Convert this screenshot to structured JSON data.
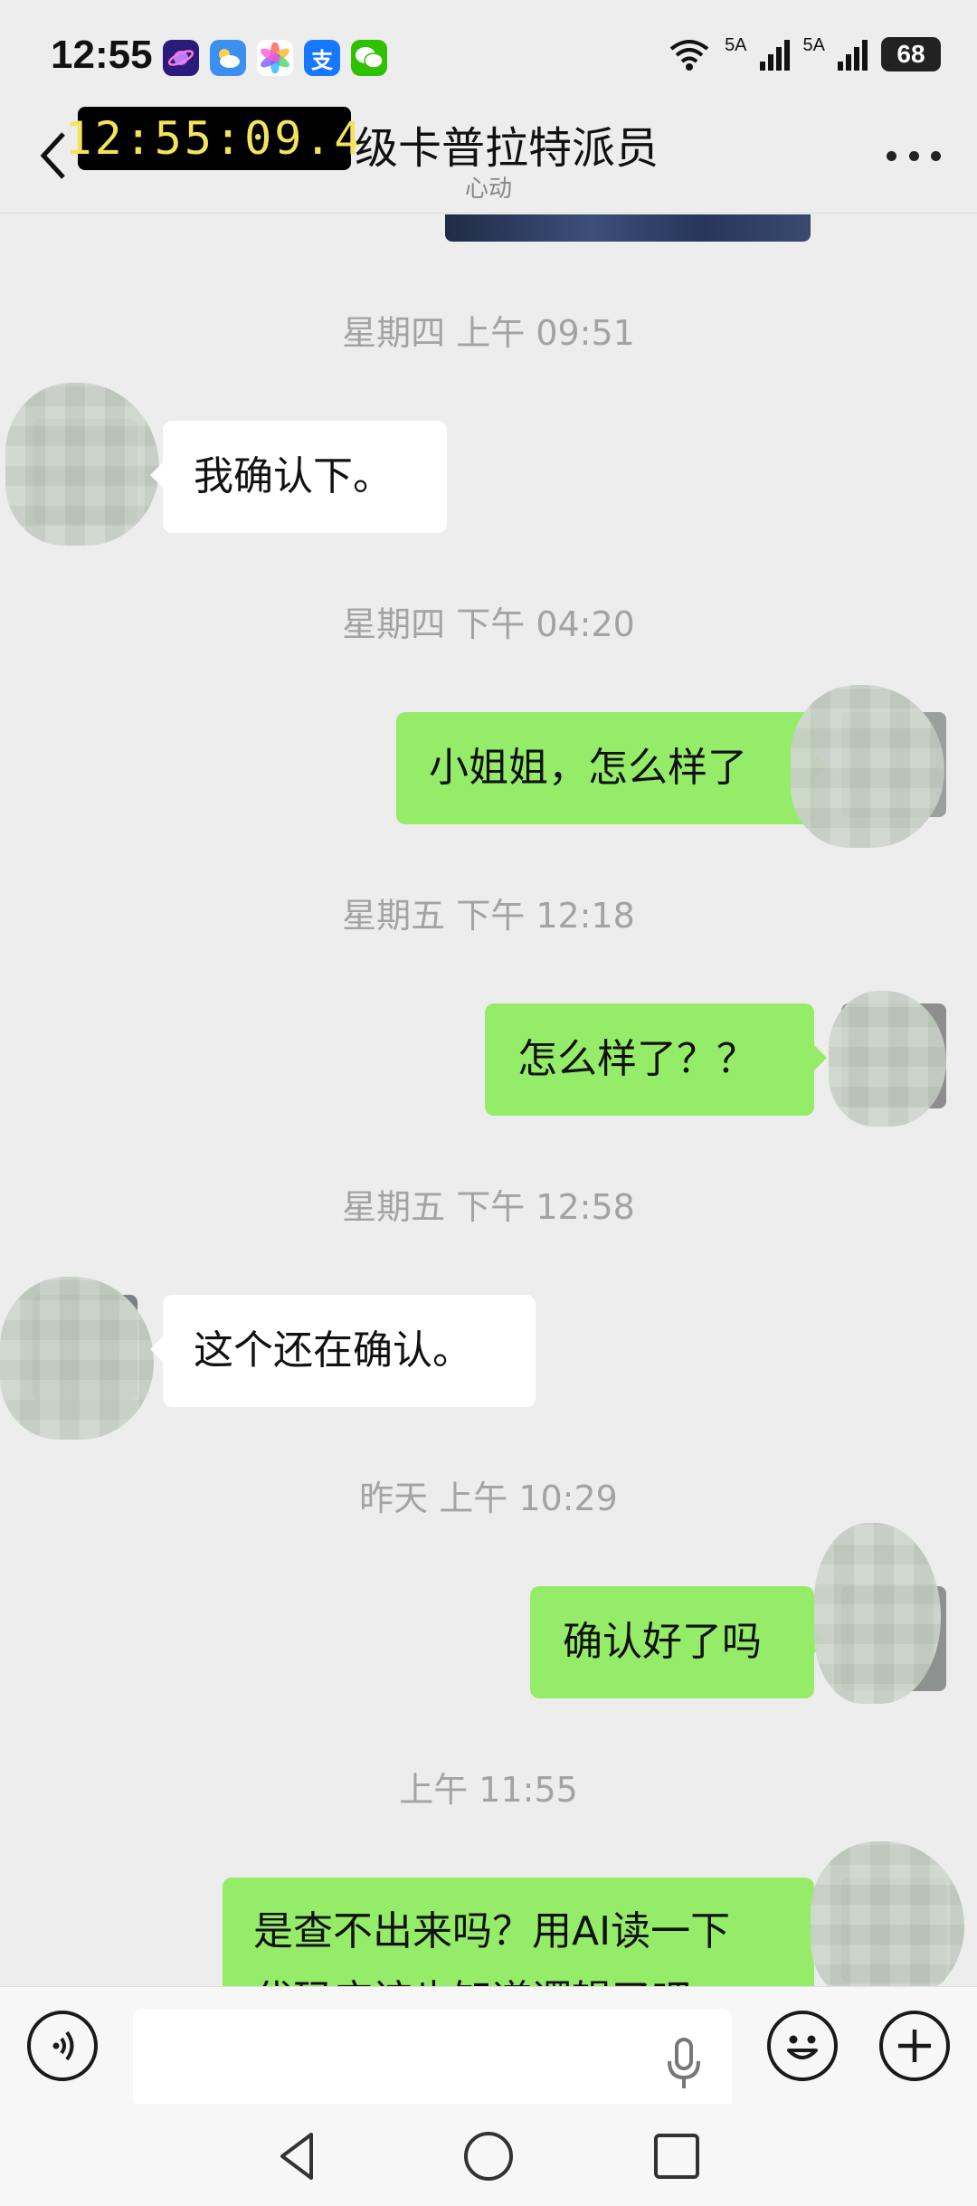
{
  "status_bar": {
    "time": "12:55",
    "signal_label_1": "5A",
    "signal_label_2": "5A",
    "battery": "68",
    "app_icons": [
      {
        "name": "planet-app-icon",
        "bg": "#2b1b7a",
        "glyph": "◎"
      },
      {
        "name": "weather-app-icon",
        "bg": "#3a8ff0",
        "glyph": "☁"
      },
      {
        "name": "photos-app-icon",
        "bg": "#ffffff",
        "glyph": "✿"
      },
      {
        "name": "alipay-app-icon",
        "bg": "#1677ff",
        "glyph": "支"
      },
      {
        "name": "wechat-app-icon",
        "bg": "#2dc100",
        "glyph": "✆"
      }
    ]
  },
  "header": {
    "clock_overlay": "12:55:09.4",
    "title": "级卡普拉特派员",
    "subtitle": "心动"
  },
  "messages": [
    {
      "type": "timestamp",
      "text": "星期四 上午 09:51"
    },
    {
      "type": "in",
      "text": "我确认下。"
    },
    {
      "type": "timestamp",
      "text": "星期四 下午 04:20"
    },
    {
      "type": "out",
      "text": "小姐姐，怎么样了"
    },
    {
      "type": "timestamp",
      "text": "星期五 下午 12:18"
    },
    {
      "type": "out",
      "text": "怎么样了？？"
    },
    {
      "type": "timestamp",
      "text": "星期五 下午 12:58"
    },
    {
      "type": "in",
      "text": "这个还在确认。"
    },
    {
      "type": "timestamp",
      "text": "昨天 上午 10:29"
    },
    {
      "type": "out",
      "text": "确认好了吗"
    },
    {
      "type": "timestamp",
      "text": "上午 11:55"
    },
    {
      "type": "out",
      "text_line1": "是查不出来吗？用AI读一下",
      "text_line2": "代码应该也知道逻辑了吧"
    }
  ],
  "colors": {
    "background": "#ededed",
    "bubble_out": "#95ec69",
    "bubble_in": "#ffffff",
    "timestamp": "#a3a3a3"
  }
}
